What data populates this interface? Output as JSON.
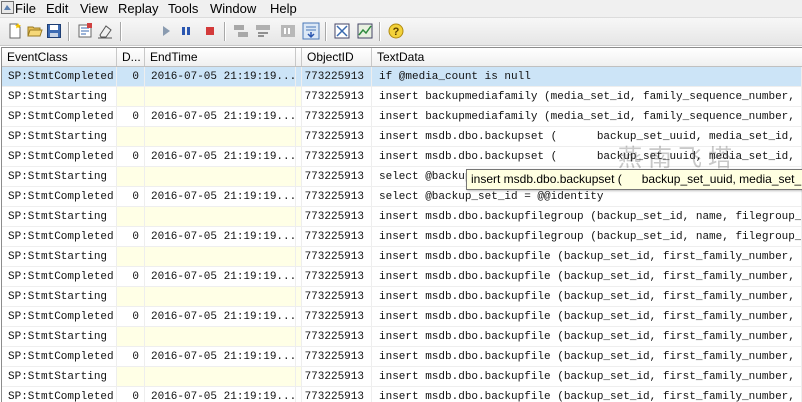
{
  "menu": [
    "File",
    "Edit",
    "View",
    "Replay",
    "Tools",
    "Window",
    "Help"
  ],
  "toolbar": {
    "icons": [
      "new-trace-icon",
      "open-icon",
      "save-icon",
      "properties-icon",
      "clear-icon",
      "start-replay-icon",
      "pause-icon",
      "stop-icon",
      "step-icon",
      "run-to-cursor-icon",
      "toggle-breakpoint-icon",
      "auto-scroll-icon",
      "activity-monitor-icon",
      "performance-icon",
      "help-icon"
    ]
  },
  "columns": [
    "EventClass",
    "D...",
    "EndTime",
    "",
    "ObjectID",
    "TextData"
  ],
  "rows": [
    {
      "event": "SP:StmtCompleted",
      "duration": "0",
      "endtime": "2016-07-05 21:19:19...",
      "objectid": "773225913",
      "text": "if @media_count is null",
      "selected": true
    },
    {
      "event": "SP:StmtStarting",
      "duration": "",
      "endtime": "",
      "objectid": "773225913",
      "text": "insert backupmediafamily (media_set_id, family_sequence_number, med..."
    },
    {
      "event": "SP:StmtCompleted",
      "duration": "0",
      "endtime": "2016-07-05 21:19:19...",
      "objectid": "773225913",
      "text": "insert backupmediafamily (media_set_id, family_sequence_number, med..."
    },
    {
      "event": "SP:StmtStarting",
      "duration": "",
      "endtime": "",
      "objectid": "773225913",
      "text": "insert msdb.dbo.backupset (      backup_set_uuid, media_set_id, firs..."
    },
    {
      "event": "SP:StmtCompleted",
      "duration": "0",
      "endtime": "2016-07-05 21:19:19...",
      "objectid": "773225913",
      "text": "insert msdb.dbo.backupset (      backup_set_uuid, media_set_id, firs..."
    },
    {
      "event": "SP:StmtStarting",
      "duration": "",
      "endtime": "",
      "objectid": "773225913",
      "text": "select @backup_set_id = @@identity"
    },
    {
      "event": "SP:StmtCompleted",
      "duration": "0",
      "endtime": "2016-07-05 21:19:19...",
      "objectid": "773225913",
      "text": "select @backup_set_id = @@identity"
    },
    {
      "event": "SP:StmtStarting",
      "duration": "",
      "endtime": "",
      "objectid": "773225913",
      "text": "insert msdb.dbo.backupfilegroup (backup_set_id, name, filegroup_id,..."
    },
    {
      "event": "SP:StmtCompleted",
      "duration": "0",
      "endtime": "2016-07-05 21:19:19...",
      "objectid": "773225913",
      "text": "insert msdb.dbo.backupfilegroup (backup_set_id, name, filegroup_id,..."
    },
    {
      "event": "SP:StmtStarting",
      "duration": "",
      "endtime": "",
      "objectid": "773225913",
      "text": "insert msdb.dbo.backupfile (backup_set_id, first_family_number, fir..."
    },
    {
      "event": "SP:StmtCompleted",
      "duration": "0",
      "endtime": "2016-07-05 21:19:19...",
      "objectid": "773225913",
      "text": "insert msdb.dbo.backupfile (backup_set_id, first_family_number, fir..."
    },
    {
      "event": "SP:StmtStarting",
      "duration": "",
      "endtime": "",
      "objectid": "773225913",
      "text": "insert msdb.dbo.backupfile (backup_set_id, first_family_number, fir..."
    },
    {
      "event": "SP:StmtCompleted",
      "duration": "0",
      "endtime": "2016-07-05 21:19:19...",
      "objectid": "773225913",
      "text": "insert msdb.dbo.backupfile (backup_set_id, first_family_number, fir..."
    },
    {
      "event": "SP:StmtStarting",
      "duration": "",
      "endtime": "",
      "objectid": "773225913",
      "text": "insert msdb.dbo.backupfile (backup_set_id, first_family_number, fir..."
    },
    {
      "event": "SP:StmtCompleted",
      "duration": "0",
      "endtime": "2016-07-05 21:19:19...",
      "objectid": "773225913",
      "text": "insert msdb.dbo.backupfile (backup_set_id, first_family_number, fir..."
    },
    {
      "event": "SP:StmtStarting",
      "duration": "",
      "endtime": "",
      "objectid": "773225913",
      "text": "insert msdb.dbo.backupfile (backup_set_id, first_family_number, fir..."
    },
    {
      "event": "SP:StmtCompleted",
      "duration": "0",
      "endtime": "2016-07-05 21:19:19...",
      "objectid": "773225913",
      "text": "insert msdb.dbo.backupfile (backup_set_id, first_family_number, fir..."
    }
  ],
  "tooltip": "insert msdb.dbo.backupset (      backup_set_uuid, media_set_id, first_f",
  "watermark": "燕南飞塔"
}
